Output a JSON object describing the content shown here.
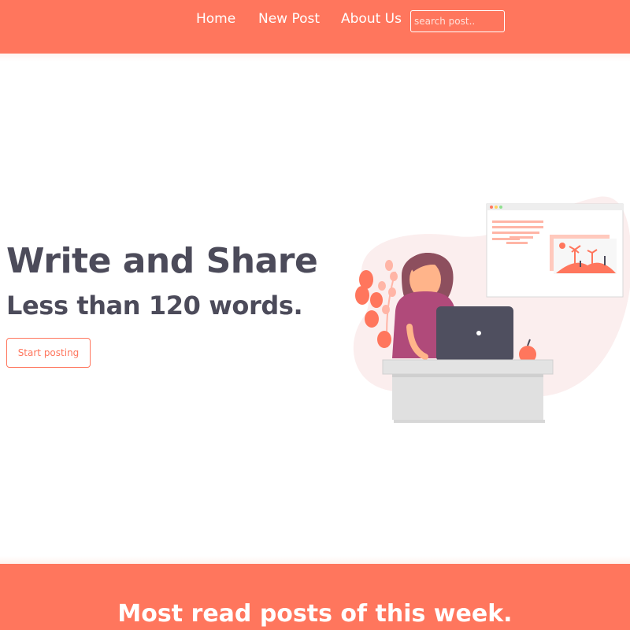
{
  "nav": {
    "items": [
      "Home",
      "New Post",
      "About Us"
    ],
    "search_placeholder": "search post.."
  },
  "hero": {
    "title": "Write and Share",
    "subtitle": "Less than 120 words.",
    "cta_label": "Start posting",
    "illustration": "woman-at-laptop-illustration"
  },
  "section": {
    "title": "Most read posts of this week."
  },
  "colors": {
    "brand": "#ff765d",
    "text_dark": "#4c4b5a",
    "white": "#ffffff"
  }
}
